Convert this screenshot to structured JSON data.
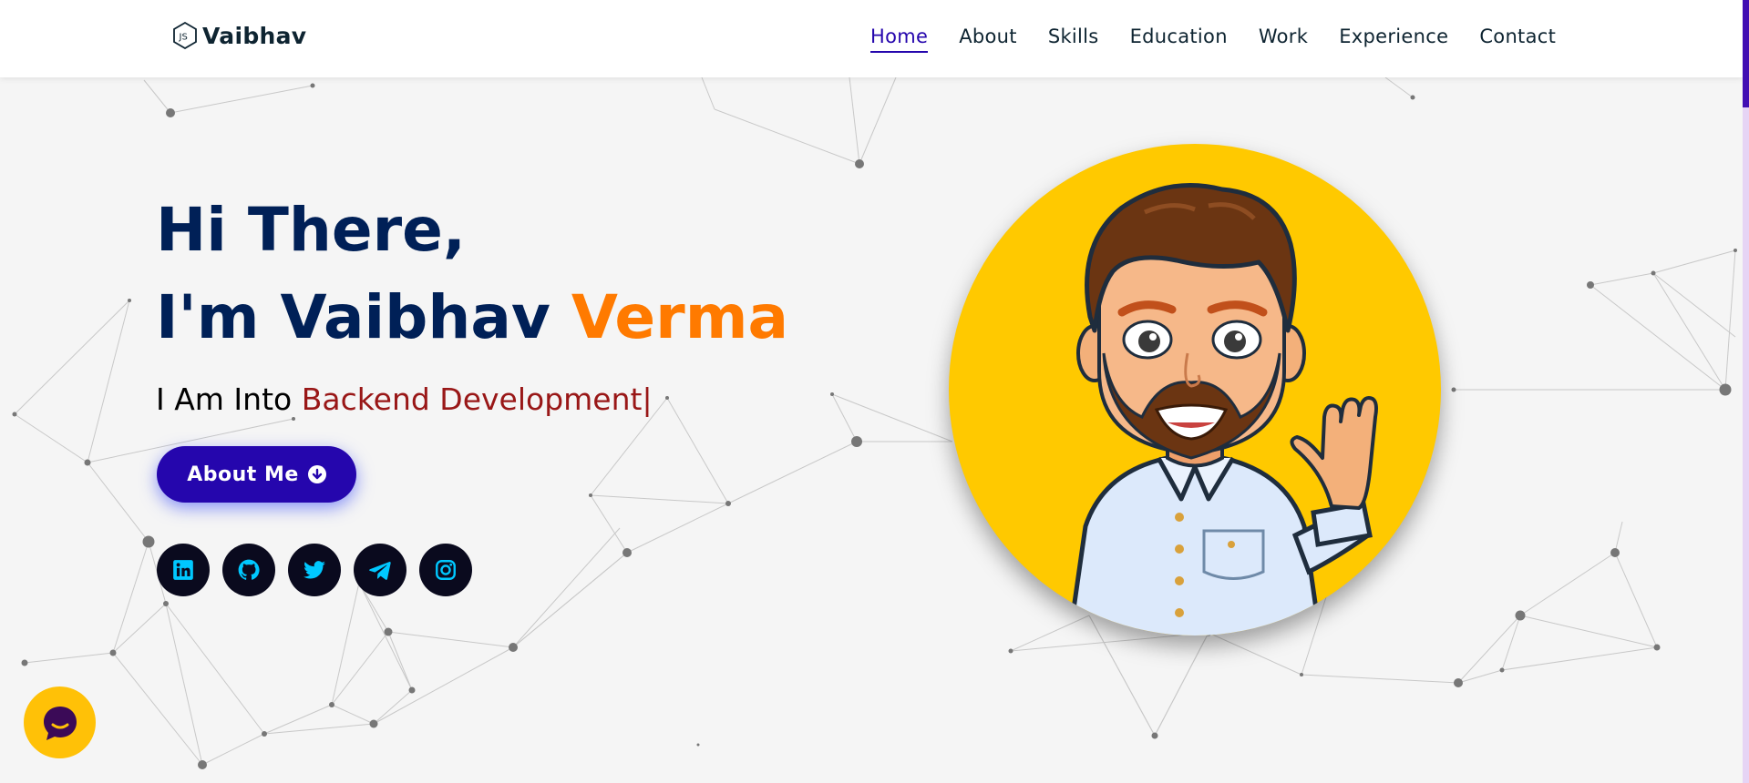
{
  "brand": {
    "name": "Vaibhav",
    "icon": "nodejs-hexagon-icon"
  },
  "nav": {
    "items": [
      {
        "label": "Home",
        "active": true
      },
      {
        "label": "About",
        "active": false
      },
      {
        "label": "Skills",
        "active": false
      },
      {
        "label": "Education",
        "active": false
      },
      {
        "label": "Work",
        "active": false
      },
      {
        "label": "Experience",
        "active": false
      },
      {
        "label": "Contact",
        "active": false
      }
    ]
  },
  "hero": {
    "line1": "Hi There,",
    "line2_prefix": "I'm Vaibhav ",
    "line2_highlight": "Verma",
    "typing_prefix": "I Am Into ",
    "typing_text": "Backend Development",
    "typing_cursor": "|",
    "button_label": "About Me",
    "button_icon": "arrow-circle-down-icon"
  },
  "socials": [
    {
      "name": "linkedin",
      "icon": "linkedin-icon"
    },
    {
      "name": "github",
      "icon": "github-icon"
    },
    {
      "name": "twitter",
      "icon": "twitter-icon"
    },
    {
      "name": "telegram",
      "icon": "telegram-icon"
    },
    {
      "name": "instagram",
      "icon": "instagram-icon"
    }
  ],
  "avatar": {
    "description_icon": "waving-cartoon-avatar"
  },
  "chat": {
    "icon": "chat-bubble-icon"
  },
  "colors": {
    "primary": "#2506ad",
    "heading": "#002057",
    "accent": "#ff7a00",
    "typing": "#991717",
    "social_icon": "#00c8ff",
    "avatar_bg": "#ffc900",
    "scroll_thumb": "#420eb3"
  }
}
